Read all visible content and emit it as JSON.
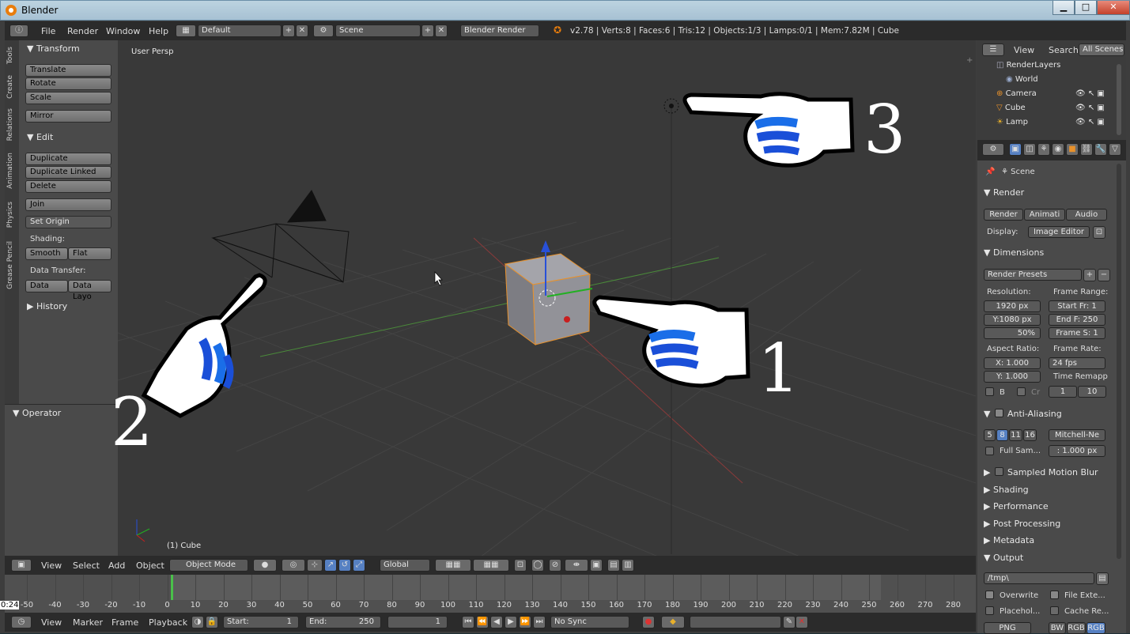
{
  "window": {
    "title": "Blender",
    "min": "▁",
    "max": "□",
    "close": "✕"
  },
  "menu": {
    "items": [
      "File",
      "Render",
      "Window",
      "Help"
    ],
    "layout": "Default",
    "scene": "Scene",
    "engine": "Blender Render",
    "info": "v2.78 | Verts:8 | Faces:6 | Tris:12 | Objects:1/3 | Lamps:0/1 | Mem:7.82M | Cube"
  },
  "tabs": [
    "Tools",
    "Create",
    "Relations",
    "Animation",
    "Physics",
    "Grease Pencil"
  ],
  "tools": {
    "transform": "Transform",
    "translate": "Translate",
    "rotate": "Rotate",
    "scale": "Scale",
    "mirror": "Mirror",
    "edit": "Edit",
    "duplicate": "Duplicate",
    "duplicate_linked": "Duplicate Linked",
    "delete": "Delete",
    "join": "Join",
    "set_origin": "Set Origin",
    "shading": "Shading:",
    "smooth": "Smooth",
    "flat": "Flat",
    "data_transfer": "Data Transfer:",
    "data": "Data",
    "data_layo": "Data Layo",
    "history": "History",
    "operator": "Operator"
  },
  "viewport": {
    "label": "User Persp",
    "object": "(1) Cube"
  },
  "annotations": [
    "1",
    "2",
    "3"
  ],
  "header3d": {
    "view": "View",
    "select": "Select",
    "add": "Add",
    "object": "Object",
    "mode": "Object Mode",
    "orientation": "Global"
  },
  "timeline": {
    "ticks": [
      "-50",
      "-40",
      "-30",
      "-20",
      "-10",
      "0",
      "10",
      "20",
      "30",
      "40",
      "50",
      "60",
      "70",
      "80",
      "90",
      "100",
      "110",
      "120",
      "130",
      "140",
      "150",
      "160",
      "170",
      "180",
      "190",
      "200",
      "210",
      "220",
      "230",
      "240",
      "250",
      "260",
      "270",
      "280"
    ],
    "time": "0:24"
  },
  "tlbar": {
    "view": "View",
    "marker": "Marker",
    "frame": "Frame",
    "playback": "Playback",
    "start_label": "Start:",
    "start": "1",
    "end_label": "End:",
    "end": "250",
    "current": "1",
    "sync": "No Sync"
  },
  "outliner": {
    "view": "View",
    "search": "Search",
    "scenes": "All Scenes",
    "rows": [
      "RenderLayers",
      "World",
      "Camera",
      "Cube",
      "Lamp"
    ]
  },
  "props": {
    "scene": "Scene",
    "render": "Render",
    "render_btn": "Render",
    "animation_btn": "Animati",
    "audio_btn": "Audio",
    "display_label": "Display:",
    "display": "Image Editor",
    "dimensions": "Dimensions",
    "presets": "Render Presets",
    "resolution": "Resolution:",
    "res_x": "1920 px",
    "res_y": "Y:1080 px",
    "res_pct": "50%",
    "frame_range": "Frame Range:",
    "start_fr": "Start Fr: 1",
    "end_fr": "End F: 250",
    "frame_s": "Frame S: 1",
    "aspect": "Aspect Ratio:",
    "asp_x": "X: 1.000",
    "asp_y": "Y: 1.000",
    "frame_rate": "Frame Rate:",
    "fps": "24 fps",
    "time_remap": "Time Remapp",
    "b": "B",
    "c": "Cr",
    "remap_old": "1",
    "remap_new": "10",
    "aa": "Anti-Aliasing",
    "aa_vals": [
      "5",
      "8",
      "11",
      "16"
    ],
    "filter": "Mitchell-Ne",
    "full_sample": "Full Sam...",
    "filter_size": ": 1.000 px",
    "motion_blur": "Sampled Motion Blur",
    "shading": "Shading",
    "performance": "Performance",
    "post": "Post Processing",
    "metadata": "Metadata",
    "output": "Output",
    "path": "/tmp\\",
    "overwrite": "Overwrite",
    "file_ext": "File Exte...",
    "placeholder": "Placehol...",
    "cache": "Cache Re...",
    "png": "PNG",
    "bw": "BW",
    "rgb": "RGB",
    "rgba": "RGB"
  }
}
